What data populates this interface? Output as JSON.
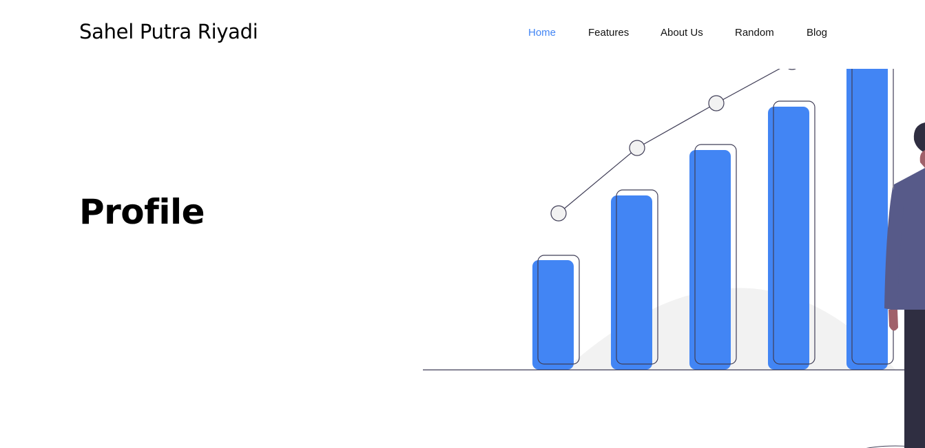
{
  "brand": {
    "name": "Sahel Putra Riyadi"
  },
  "nav": {
    "items": [
      {
        "label": "Home",
        "active": true
      },
      {
        "label": "Features",
        "active": false
      },
      {
        "label": "About Us",
        "active": false
      },
      {
        "label": "Random",
        "active": false
      },
      {
        "label": "Blog",
        "active": false
      }
    ]
  },
  "hero": {
    "title": "Profile"
  },
  "colors": {
    "accent": "#4285f4",
    "bar": "#4285f4",
    "outline": "#3f3d56",
    "person_jacket": "#575a89",
    "person_dark": "#2f2e41",
    "skin": "#a0616a",
    "ground_shadow": "#f2f2f2"
  }
}
